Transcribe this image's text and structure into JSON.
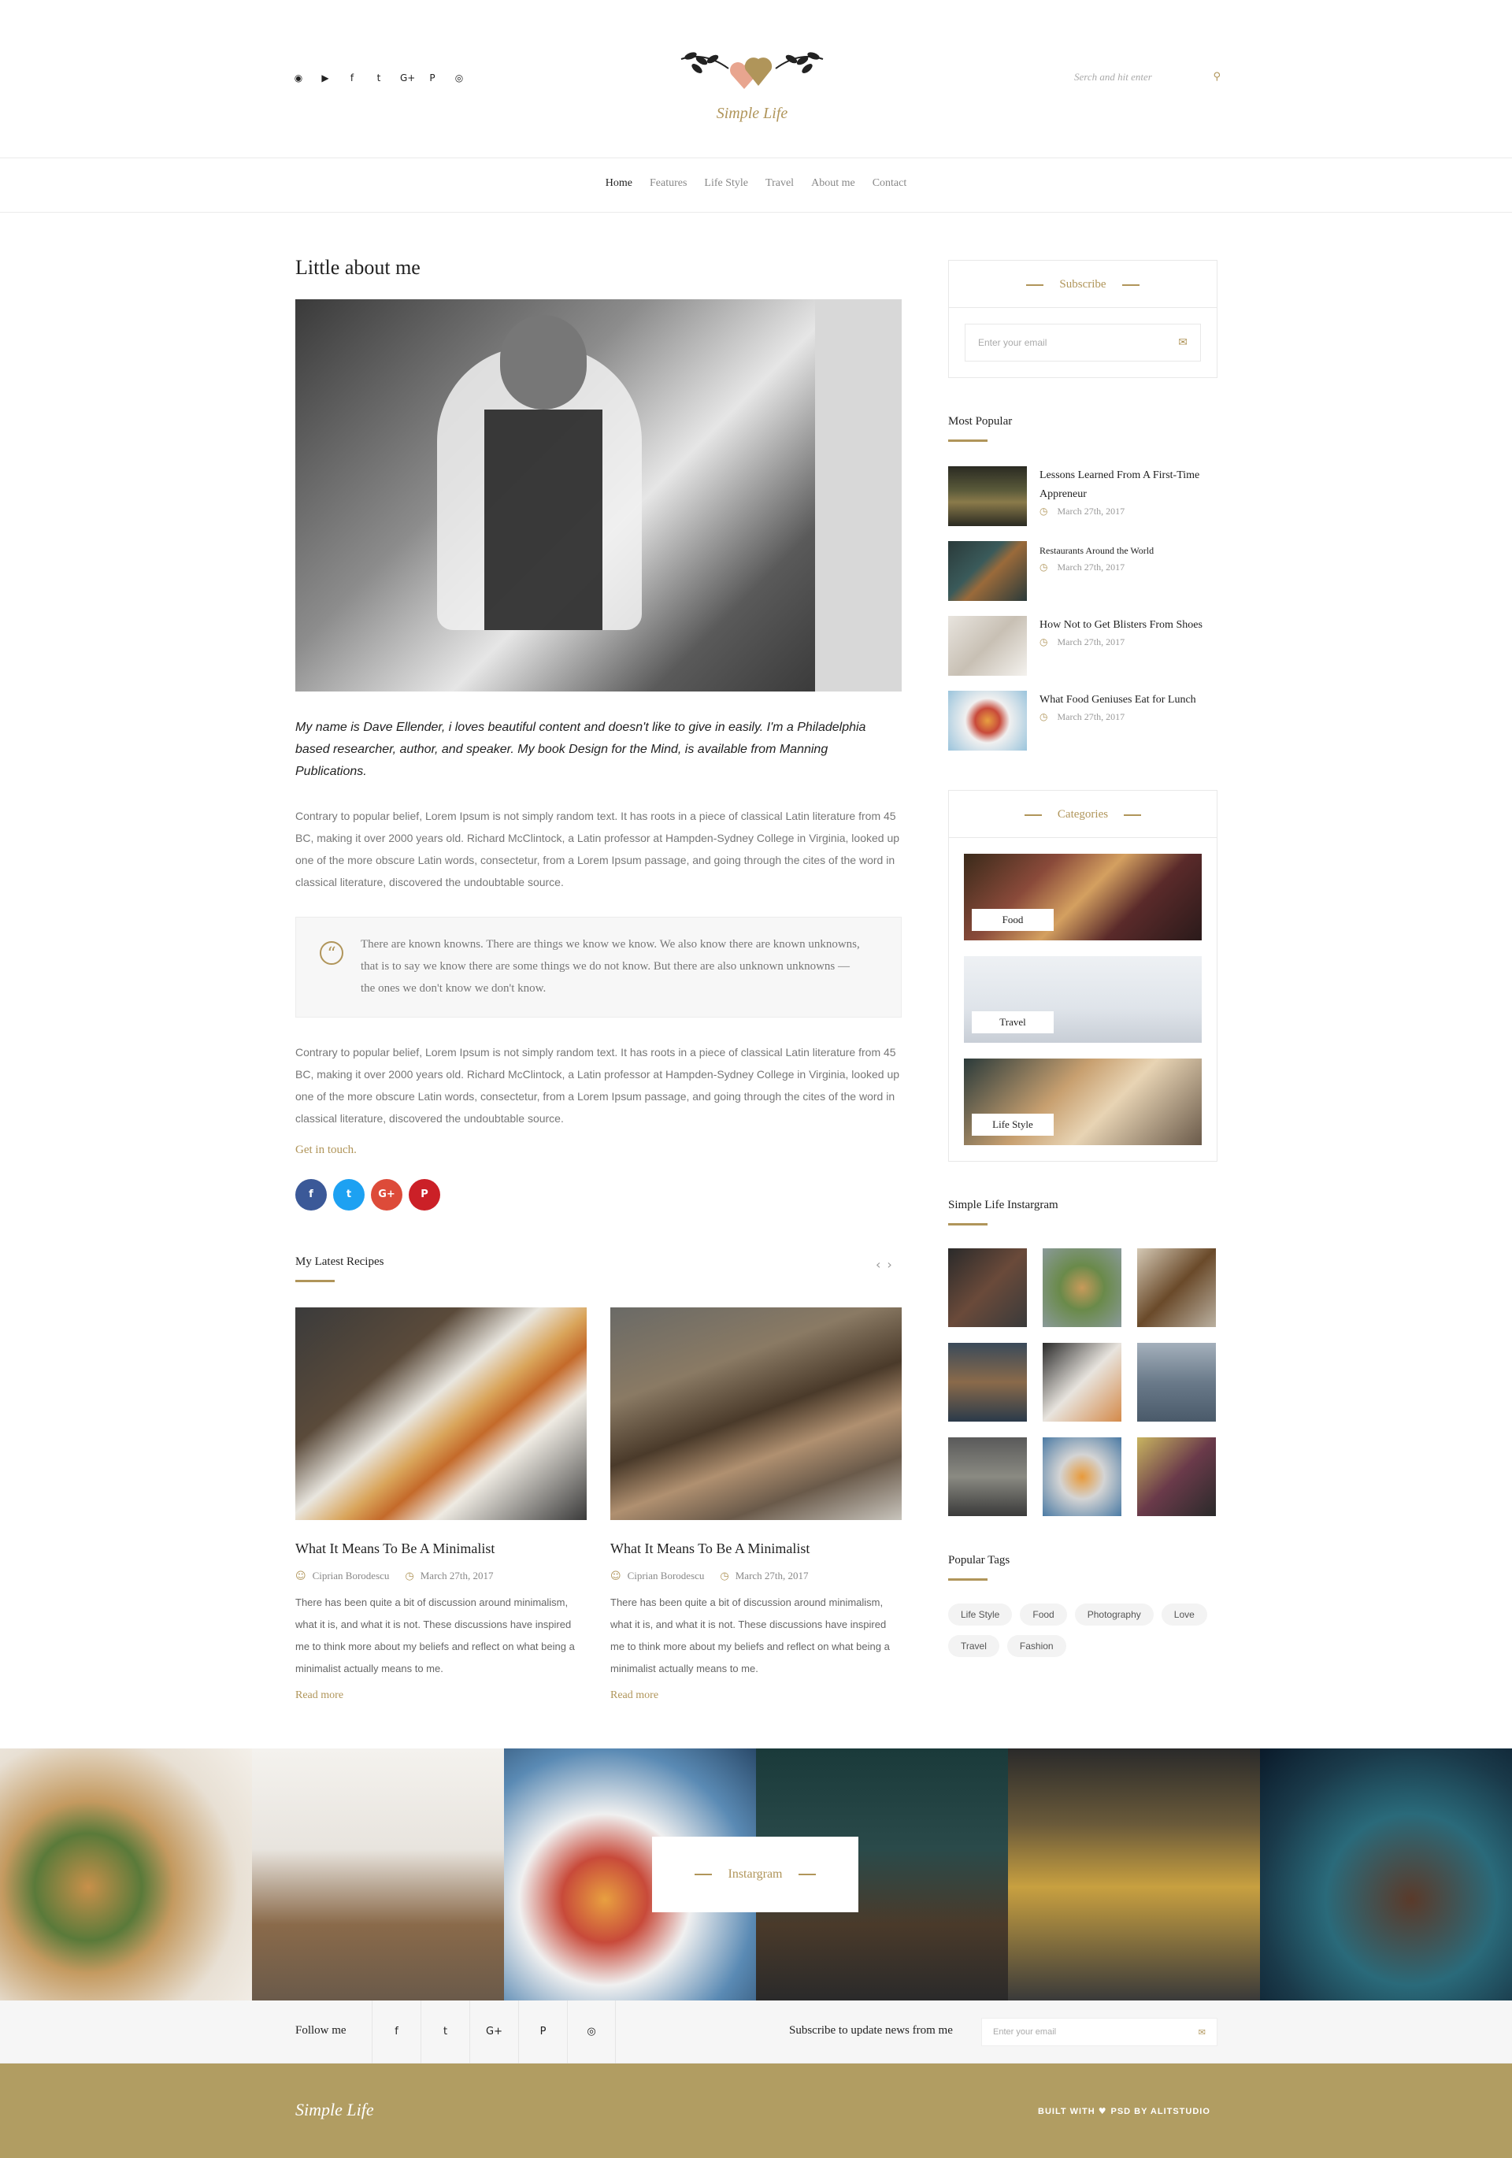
{
  "header": {
    "social_icons": [
      "rss-icon",
      "youtube-icon",
      "facebook-icon",
      "twitter-icon",
      "google-plus-icon",
      "pinterest-icon",
      "instagram-icon"
    ],
    "logo_text": "Simple Life",
    "search_placeholder": "Serch and hit enter"
  },
  "nav": {
    "items": [
      "Home",
      "Features",
      "Life Style",
      "Travel",
      "About me",
      "Contact"
    ],
    "active": "Home"
  },
  "main": {
    "title": "Little about me",
    "intro": "My name is Dave Ellender, i loves beautiful content and doesn't like to give in easily. I'm a Philadelphia based researcher, author, and speaker. My book Design for the Mind, is available from Manning Publications.",
    "para1": "Contrary to popular belief, Lorem Ipsum is not simply random text. It has roots in a piece of classical Latin literature from 45 BC, making it over 2000 years old. Richard McClintock, a Latin professor at Hampden-Sydney College in Virginia, looked up one of the more obscure Latin words, consectetur, from a Lorem Ipsum passage, and going through the cites of the word in classical literature, discovered the undoubtable source.",
    "quote": "There are known knowns. There are things we know we know. We also know there are known unknowns, that is to say we know there are some things we do not know. But there are also unknown unknowns — the ones we don't know we don't know.",
    "para2": "Contrary to popular belief, Lorem Ipsum is not simply random text. It has roots in a piece of classical Latin literature from 45 BC, making it over 2000 years old. Richard McClintock, a Latin professor at Hampden-Sydney College in Virginia, looked up one of the more obscure Latin words, consectetur, from a Lorem Ipsum passage, and going through the cites of the word in classical literature, discovered the undoubtable source.",
    "get_in_touch": "Get in touch.",
    "share_labels": [
      "f",
      "t",
      "G+",
      "P"
    ]
  },
  "recipes": {
    "heading": "My Latest Recipes",
    "prev": "‹",
    "next": "›",
    "items": [
      {
        "title": "What It Means To Be A Minimalist",
        "author": "Ciprian Borodescu",
        "date": "March 27th, 2017",
        "text": "There has been quite a bit of discussion around minimalism, what it is, and what it is not. These discussions have inspired me to think more about my beliefs and reflect on what being a minimalist actually means to me.",
        "more": "Read more"
      },
      {
        "title": "What It Means To Be A Minimalist",
        "author": "Ciprian Borodescu",
        "date": "March 27th, 2017",
        "text": "There has been quite a bit of discussion around minimalism, what it is, and what it is not. These discussions have inspired me to think more about my beliefs and reflect on what being a minimalist actually means to me.",
        "more": "Read more"
      }
    ]
  },
  "sidebar": {
    "subscribe": {
      "heading": "Subscribe",
      "placeholder": "Enter your email"
    },
    "popular": {
      "heading": "Most Popular",
      "items": [
        {
          "title": "Lessons Learned From A First-Time Appreneur",
          "date": "March 27th, 2017"
        },
        {
          "title": "Restaurants Around the World",
          "date": "March 27th, 2017"
        },
        {
          "title": "How Not to Get Blisters From Shoes",
          "date": "March 27th, 2017"
        },
        {
          "title": "What Food Geniuses Eat for Lunch",
          "date": "March 27th, 2017"
        }
      ]
    },
    "categories": {
      "heading": "Categories",
      "items": [
        "Food",
        "Travel",
        "Life Style"
      ]
    },
    "instagram": {
      "heading": "Simple Life Instargram"
    },
    "tags": {
      "heading": "Popular Tags",
      "items": [
        "Life Style",
        "Food",
        "Photography",
        "Love",
        "Travel",
        "Fashion"
      ]
    }
  },
  "instagram_strip": {
    "label": "Instargram"
  },
  "follow": {
    "label": "Follow me",
    "icons": [
      "f",
      "t",
      "G+",
      "P",
      "◎"
    ],
    "subscribe_label": "Subscribe to update news from me",
    "placeholder": "Enter your email"
  },
  "footer": {
    "logo": "Simple Life",
    "built_prefix": "BUILT WITH",
    "built_suffix": "PSD BY ALITSTUDIO"
  },
  "colors": {
    "accent": "#b0955a",
    "footer_bg": "#b19d62"
  }
}
